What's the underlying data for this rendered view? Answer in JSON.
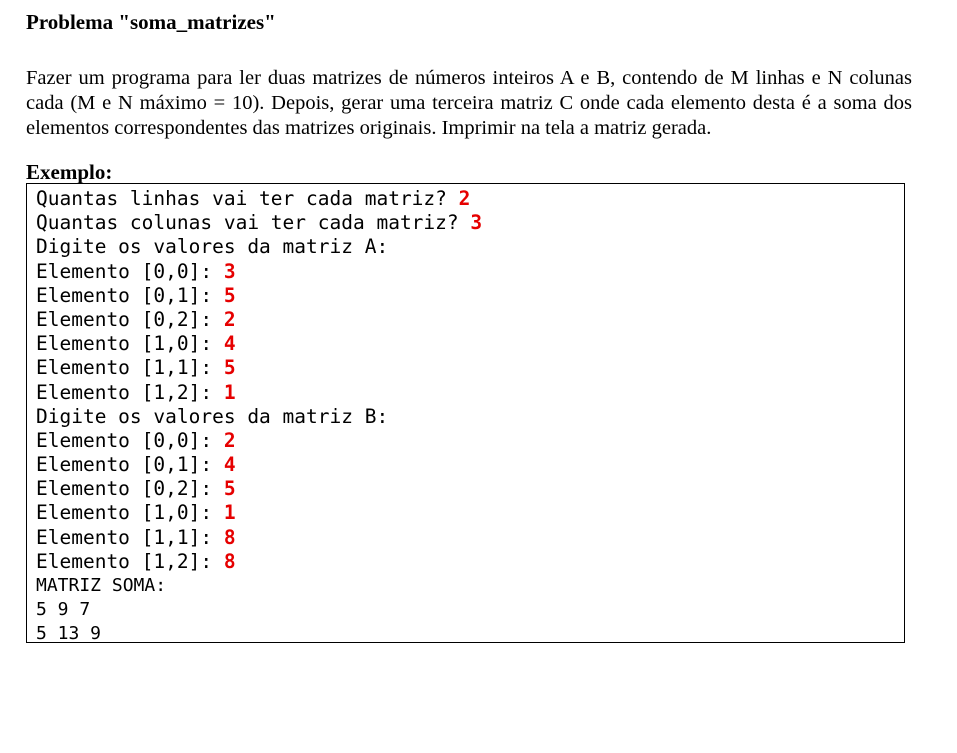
{
  "problem": {
    "title": "Problema \"soma_matrizes\"",
    "description": "Fazer um programa para ler duas matrizes de números inteiros A e B, contendo de M linhas e N colunas cada (M e N máximo = 10). Depois, gerar uma terceira matriz C onde cada elemento desta é a soma dos elementos correspondentes das matrizes originais. Imprimir na tela a matriz gerada.",
    "example_label": "Exemplo:"
  },
  "console": {
    "input_color": "#e60000",
    "lines": [
      {
        "prompt": "Quantas linhas vai ter cada matriz? ",
        "input": "2"
      },
      {
        "prompt": "Quantas colunas vai ter cada matriz? ",
        "input": "3"
      },
      {
        "prompt": "Digite os valores da matriz A:",
        "input": ""
      },
      {
        "prompt": "Elemento [0,0]: ",
        "input": "3"
      },
      {
        "prompt": "Elemento [0,1]: ",
        "input": "5"
      },
      {
        "prompt": "Elemento [0,2]: ",
        "input": "2"
      },
      {
        "prompt": "Elemento [1,0]: ",
        "input": "4"
      },
      {
        "prompt": "Elemento [1,1]: ",
        "input": "5"
      },
      {
        "prompt": "Elemento [1,2]: ",
        "input": "1"
      },
      {
        "prompt": "Digite os valores da matriz B:",
        "input": ""
      },
      {
        "prompt": "Elemento [0,0]: ",
        "input": "2"
      },
      {
        "prompt": "Elemento [0,1]: ",
        "input": "4"
      },
      {
        "prompt": "Elemento [0,2]: ",
        "input": "5"
      },
      {
        "prompt": "Elemento [1,0]: ",
        "input": "1"
      },
      {
        "prompt": "Elemento [1,1]: ",
        "input": "8"
      },
      {
        "prompt": "Elemento [1,2]: ",
        "input": "8"
      },
      {
        "prompt": "MATRIZ SOMA:",
        "input": "",
        "small": true
      },
      {
        "prompt": "5 9 7",
        "input": "",
        "small": true
      },
      {
        "prompt": "5 13 9",
        "input": "",
        "small": true
      }
    ]
  }
}
